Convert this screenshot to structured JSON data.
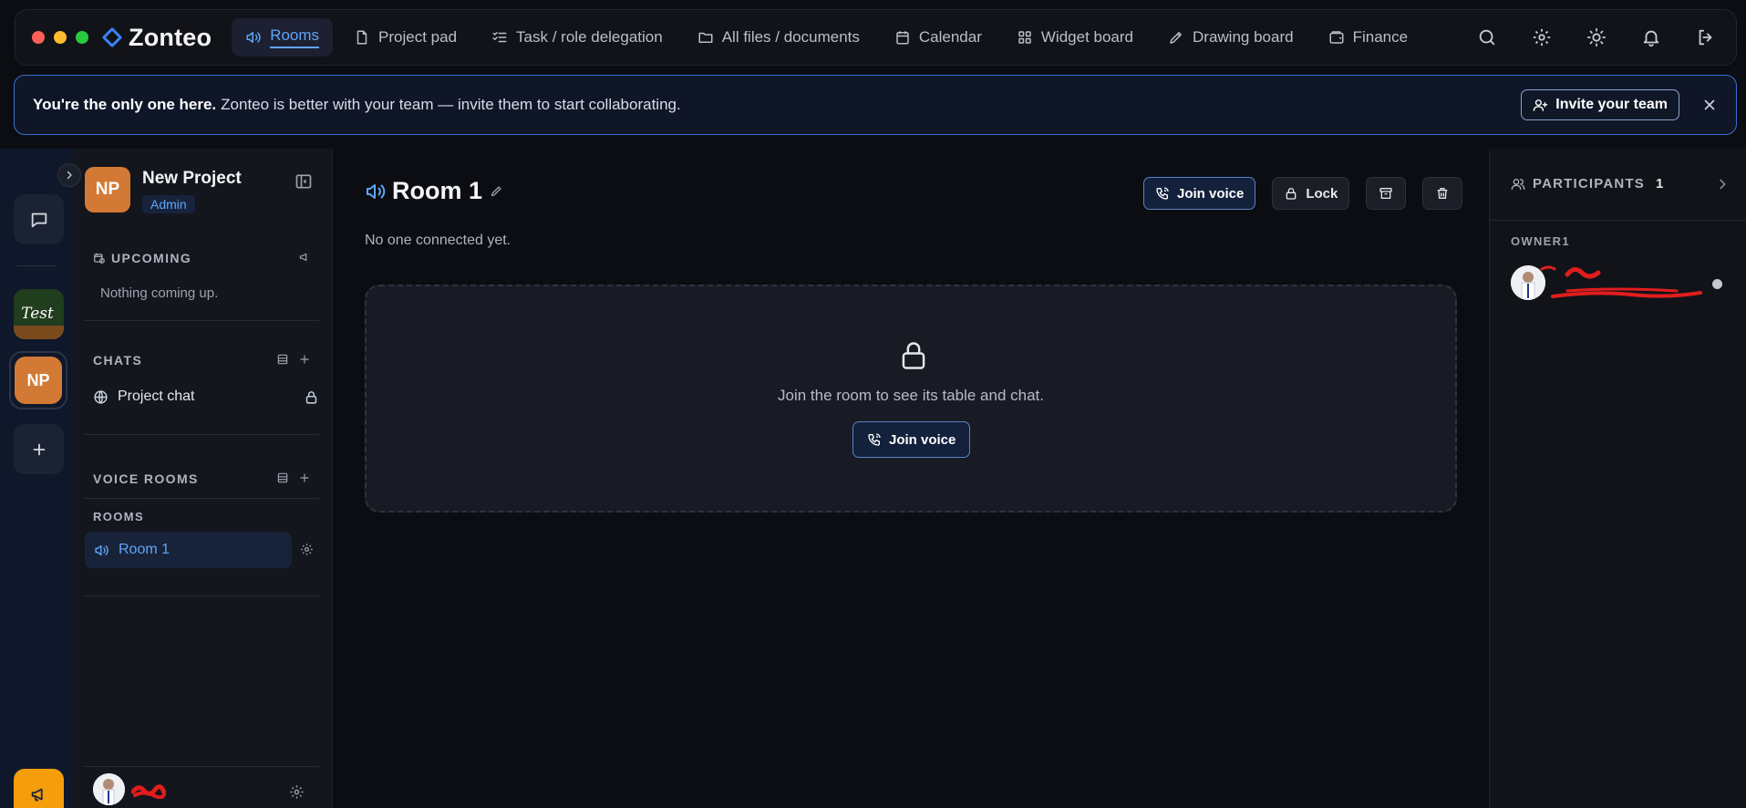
{
  "app": {
    "brand": "Zonteo",
    "colors": {
      "accent": "#60a5fa",
      "brand": "#3b82f6",
      "project": "#d27a35",
      "warning": "#f59e0b"
    }
  },
  "nav": {
    "items": [
      {
        "label": "Rooms",
        "icon": "speaker-icon",
        "active": true
      },
      {
        "label": "Project pad",
        "icon": "document-icon"
      },
      {
        "label": "Task / role delegation",
        "icon": "checklist-icon"
      },
      {
        "label": "All files / documents",
        "icon": "folder-icon"
      },
      {
        "label": "Calendar",
        "icon": "calendar-icon"
      },
      {
        "label": "Widget board",
        "icon": "grid-icon"
      },
      {
        "label": "Drawing board",
        "icon": "pen-icon"
      },
      {
        "label": "Finance",
        "icon": "wallet-icon"
      }
    ],
    "right_icons": [
      "search-icon",
      "gear-icon",
      "sun-icon",
      "bell-icon",
      "logout-icon"
    ]
  },
  "banner": {
    "lead": "You're the only one here.",
    "text": "Zonteo is better with your team — invite them to start collaborating.",
    "invite_label": "Invite your team"
  },
  "rail": {
    "items": [
      "chat-icon",
      "workspace-test",
      "workspace-np",
      "plus-icon",
      "megaphone-icon"
    ],
    "test_label": "Test",
    "np_initials": "NP"
  },
  "sidebar": {
    "project_initials": "NP",
    "project_name": "New Project",
    "role": "Admin",
    "upcoming_title": "UPCOMING",
    "upcoming_empty": "Nothing coming up.",
    "chats_title": "CHATS",
    "chats": [
      {
        "label": "Project chat",
        "locked": true
      }
    ],
    "voice_rooms_title": "VOICE ROOMS",
    "rooms_subtitle": "ROOMS",
    "rooms": [
      {
        "label": "Room 1",
        "active": true
      }
    ]
  },
  "main": {
    "room_name": "Room 1",
    "status": "No one connected yet.",
    "join_voice_label": "Join voice",
    "lock_label": "Lock",
    "placeholder_text": "Join the room to see its table and chat.",
    "placeholder_join_label": "Join voice"
  },
  "participants": {
    "title": "PARTICIPANTS",
    "count": "1",
    "owner_label": "OWNER1"
  }
}
